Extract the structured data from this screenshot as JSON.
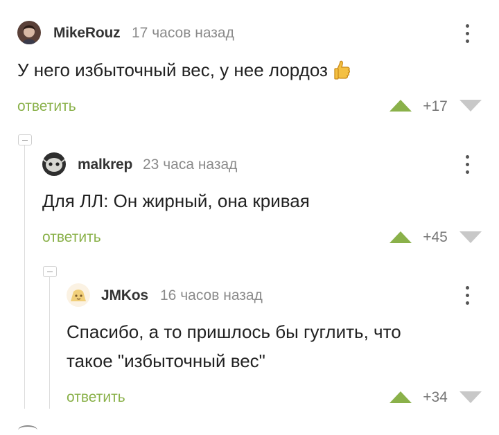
{
  "comments": [
    {
      "username": "MikeRouz",
      "time": "17 часов назад",
      "text_lines": [
        "У него избыточный вес, у нее лордоз"
      ],
      "reply_label": "ответить",
      "rating": "+17"
    },
    {
      "username": "malkrep",
      "time": "23 часа назад",
      "text_lines": [
        "Для ЛЛ: Он жирный, она кривая"
      ],
      "reply_label": "ответить",
      "rating": "+45"
    },
    {
      "username": "JMKos",
      "time": "16 часов назад",
      "text_lines": [
        "Спасибо, а то пришлось бы гуглить, что",
        "такое \"избыточный вес\""
      ],
      "reply_label": "ответить",
      "rating": "+34"
    }
  ],
  "colors": {
    "accent": "#8ab14a",
    "muted": "#8a8a8a",
    "vote_down": "#c8c8c8"
  },
  "icons": {
    "more": "more-vertical-icon",
    "upvote": "triangle-up-icon",
    "downvote": "triangle-down-icon",
    "collapse": "minus-box-icon",
    "emoji": "thumbs-up-emoji"
  }
}
